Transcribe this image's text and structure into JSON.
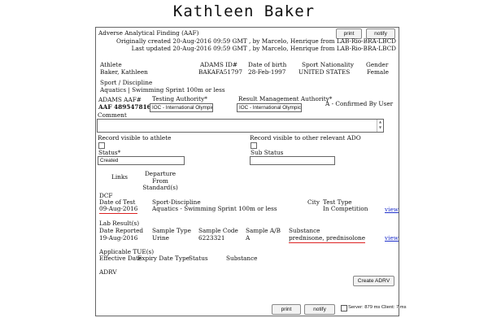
{
  "page_title": "Kathleen Baker",
  "header": {
    "form_title": "Adverse Analytical Finding (AAF)",
    "print_label": "print",
    "notify_label": "notify",
    "created_line": "Originally created 20-Aug-2016 09:59 GMT , by Marcelo, Henrique from LAB-Rio-BRA-LBCD",
    "updated_line": "Last updated 20-Aug-2016 09:59 GMT , by Marcelo, Henrique from LAB-Rio-BRA-LBCD"
  },
  "athlete": {
    "athlete_label": "Athlete",
    "athlete_value": "Baker, Kathleen",
    "adams_label": "ADAMS ID#",
    "adams_value": "BAKAFA51797",
    "dob_label": "Date of birth",
    "dob_value": "28-Feb-1997",
    "sport_nat_label": "Sport Nationality",
    "sport_nat_value": "UNITED STATES",
    "gender_label": "Gender",
    "gender_value": "Female",
    "sport_disc_label": "Sport / Discipline",
    "sport_disc_value": "Aquatics | Swimming Sprint 100m or less"
  },
  "aaf": {
    "adams_aaf_label": "ADAMS AAF#",
    "adams_aaf_value": "AAF 489547816",
    "testing_auth_label": "Testing Authority*",
    "testing_auth_value": "IOC - International Olympic C",
    "result_mgmt_label": "Result Management Authority*",
    "result_mgmt_value": "IOC - International Olympic C",
    "confirmed": "A - Confirmed By User",
    "comment_label": "Comment",
    "comment_value": "",
    "record_athlete_label": "Record visible to athlete",
    "record_ado_label": "Record visible to other relevant ADO",
    "status_label": "Status*",
    "status_value": "Created",
    "substatus_label": "Sub Status",
    "substatus_value": "",
    "links_label": "Links",
    "departure_label": "Departure From Standard(s)"
  },
  "dcf": {
    "heading": "DCF",
    "date_label": "Date of Test",
    "date_value": "09-Aug-2016",
    "sport_label": "Sport-Discipline",
    "sport_value": "Aquatics - Swimming Sprint 100m or less",
    "city_label": "City",
    "test_type_label": "Test Type",
    "test_type_value": "In Competition",
    "view_label": "view"
  },
  "lab": {
    "heading": "Lab Result(s)",
    "date_label": "Date Reported",
    "date_value": "19-Aug-2016",
    "sample_type_label": "Sample Type",
    "sample_type_value": "Urine",
    "sample_code_label": "Sample Code",
    "sample_code_value": "6223321",
    "sample_ab_label": "Sample A/B",
    "sample_ab_value": "A",
    "substance_label": "Substance",
    "substance_value": "prednisone, prednisolone",
    "view_label": "view"
  },
  "tue": {
    "heading": "Applicable TUE(s)",
    "effective_label": "Effective Date",
    "expiry_label": "Expiry Date",
    "type_label": "Type",
    "status_label": "Status",
    "substance_label": "Substance"
  },
  "adrv": {
    "heading": "ADRV",
    "create_label": "Create ADRV"
  },
  "footer": {
    "print_label": "print",
    "notify_label": "notify",
    "server_text": "Server: 879 ms Client: 7 ms"
  }
}
